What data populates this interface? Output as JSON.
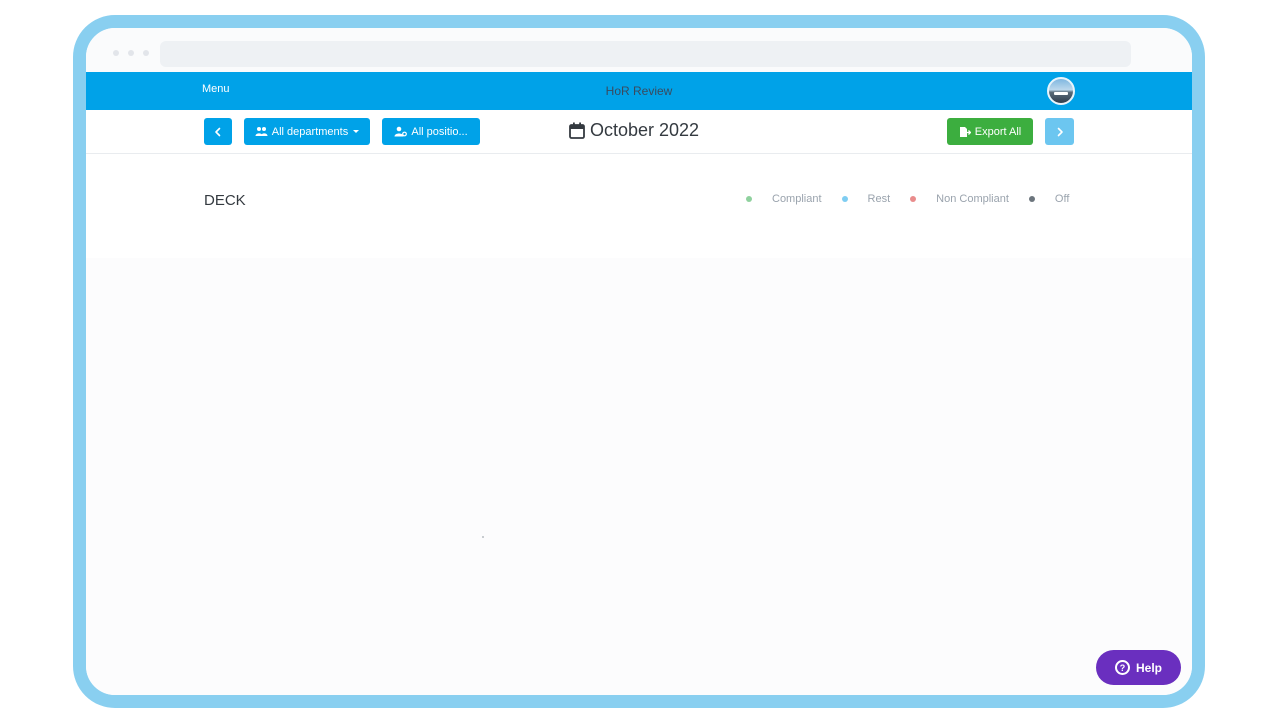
{
  "header": {
    "menu_label": "Menu",
    "title": "HoR Review",
    "avatar_icon": "avatar-icon"
  },
  "toolbar": {
    "prev_icon": "chevron-left-icon",
    "departments_label": "All departments",
    "departments_icon": "users-icon",
    "positions_label": "All positio...",
    "positions_icon": "user-cog-icon",
    "month_label": "October 2022",
    "calendar_icon": "calendar-icon",
    "export_label": "Export All",
    "export_icon": "file-export-icon",
    "next_icon": "chevron-right-icon"
  },
  "section": {
    "title": "DECK"
  },
  "legend": [
    {
      "label": "Compliant",
      "color": "#8fd19e"
    },
    {
      "label": "Rest",
      "color": "#7fcdf2"
    },
    {
      "label": "Non Compliant",
      "color": "#e98c8c"
    },
    {
      "label": "Off",
      "color": "#6c757d"
    }
  ],
  "help": {
    "label": "Help",
    "icon": "question-circle-icon"
  },
  "colors": {
    "header_blue": "#00a2e8",
    "export_green": "#3cae3f",
    "help_purple": "#6a2fbf",
    "frame": "#89cff0"
  }
}
